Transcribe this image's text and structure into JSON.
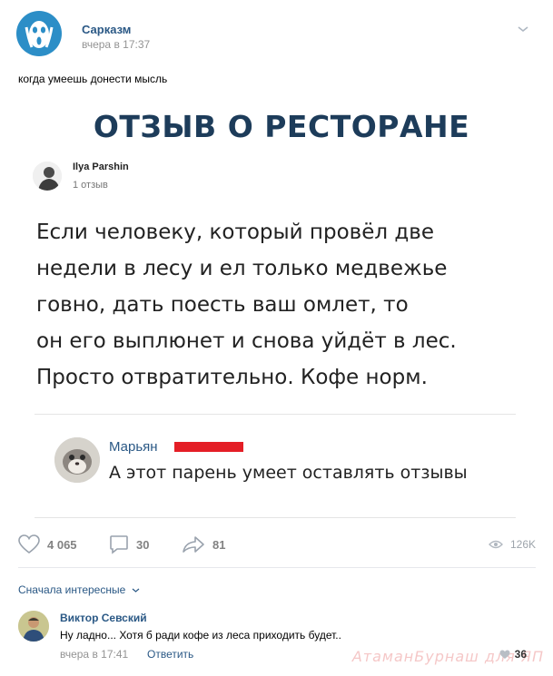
{
  "post": {
    "group_name": "Сарказм",
    "time": "вчера в 17:37",
    "text": "когда умеешь донести мысль"
  },
  "card": {
    "title": "ОТЗЫВ О РЕСТОРАНЕ",
    "author_name": "Ilya Parshin",
    "author_reviews": "1 отзыв",
    "review_lines": [
      "Если человеку, который провёл две",
      "недели в лесу и ел только медвежье",
      "говно, дать поесть ваш омлет, то",
      "он его выплюнет и снова уйдёт в лес.",
      "Просто отвратительно. Кофе норм."
    ],
    "reply_name": "Марьян",
    "reply_text": "А этот парень умеет оставлять отзывы"
  },
  "actions": {
    "likes": "4 065",
    "comments": "30",
    "shares": "81",
    "views": "126K"
  },
  "comments": {
    "sort_label": "Сначала интересные",
    "items": [
      {
        "author": "Виктор Севский",
        "text": "Ну ладно... Хотя б ради кофе из леса приходить будет..",
        "time": "вчера в 17:41",
        "reply_label": "Ответить",
        "likes": "36"
      }
    ]
  },
  "watermark": "АтаманБурнаш для ЯП",
  "colors": {
    "link": "#2a5885",
    "title": "#1d3c5a",
    "red_bar": "#e41e26",
    "muted": "#939393"
  }
}
